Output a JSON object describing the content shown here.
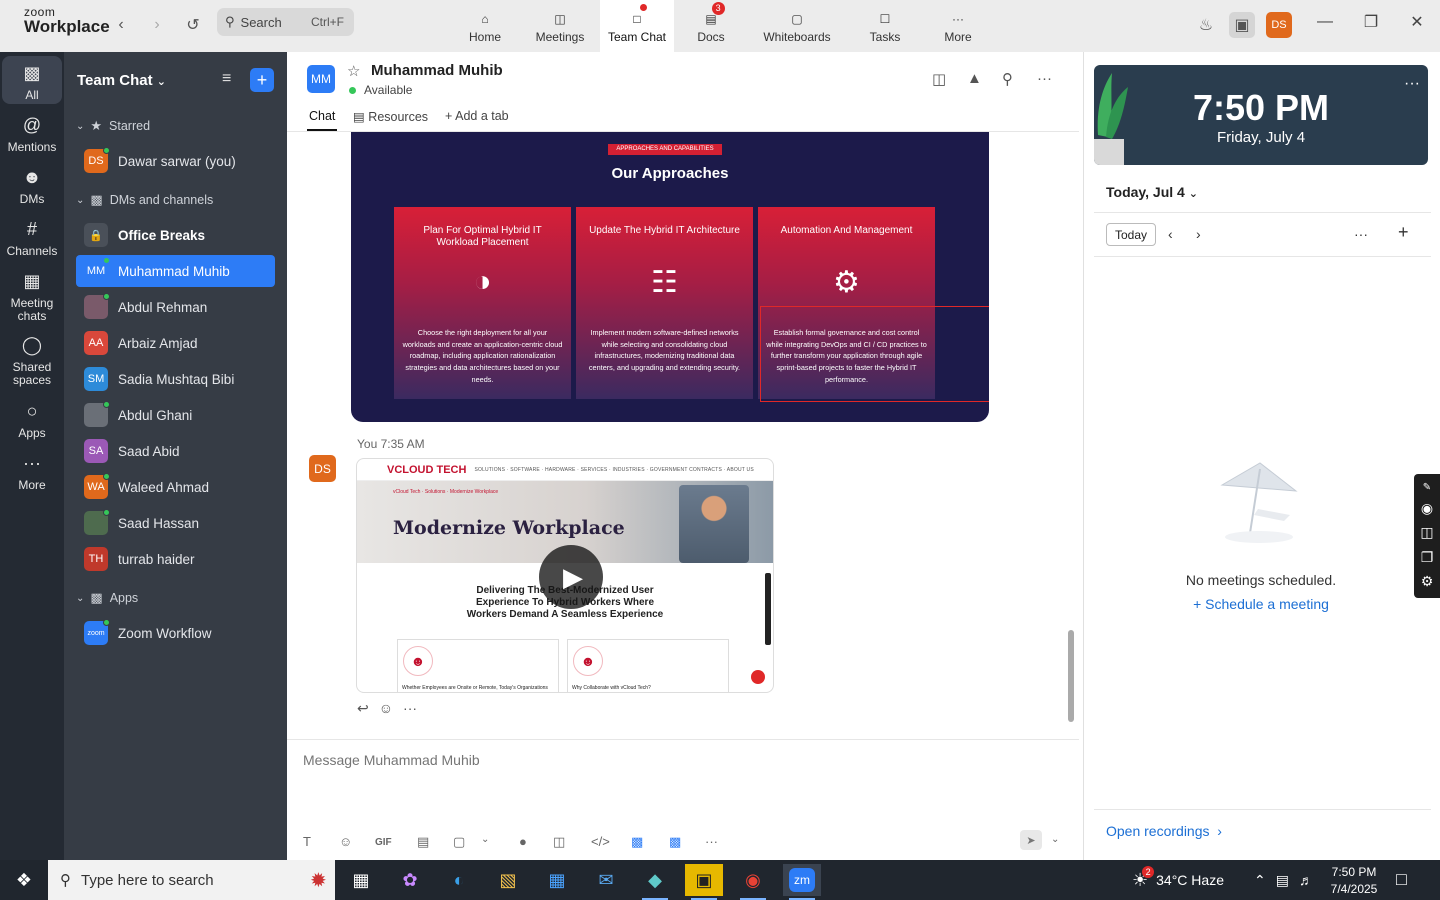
{
  "app": {
    "brand_top": "zoom",
    "brand_bottom": "Workplace"
  },
  "search": {
    "label": "Search",
    "shortcut": "Ctrl+F"
  },
  "nav": [
    {
      "label": "Home"
    },
    {
      "label": "Meetings"
    },
    {
      "label": "Team Chat"
    },
    {
      "label": "Docs",
      "badge": "3"
    },
    {
      "label": "Whiteboards"
    },
    {
      "label": "Tasks"
    },
    {
      "label": "More"
    }
  ],
  "user": {
    "initials": "DS"
  },
  "rail": [
    {
      "label": "All"
    },
    {
      "label": "Mentions"
    },
    {
      "label": "DMs"
    },
    {
      "label": "Channels"
    },
    {
      "label": "Meeting chats"
    },
    {
      "label": "Shared spaces"
    },
    {
      "label": "Apps"
    },
    {
      "label": "More"
    }
  ],
  "chatlist": {
    "title": "Team Chat",
    "sections": {
      "starred": "Starred",
      "dms": "DMs and channels",
      "apps": "Apps"
    },
    "starred": [
      {
        "initials": "DS",
        "name": "Dawar sarwar (you)",
        "color": "#e0691c"
      }
    ],
    "items": [
      {
        "initials": "",
        "name": "Office Breaks",
        "color": "#4a5059"
      },
      {
        "initials": "MM",
        "name": "Muhammad Muhib",
        "color": "#2d7cf6"
      },
      {
        "initials": "",
        "name": "Abdul Rehman",
        "color": "#7a5a6a"
      },
      {
        "initials": "AA",
        "name": "Arbaiz Amjad",
        "color": "#d9483b"
      },
      {
        "initials": "SM",
        "name": "Sadia Mushtaq Bibi",
        "color": "#2d8bd9"
      },
      {
        "initials": "",
        "name": "Abdul Ghani",
        "color": "#6a6f77"
      },
      {
        "initials": "SA",
        "name": "Saad Abid",
        "color": "#9b59b6"
      },
      {
        "initials": "WA",
        "name": "Waleed Ahmad",
        "color": "#e0691c"
      },
      {
        "initials": "",
        "name": "Saad Hassan",
        "color": "#4e6b4e"
      },
      {
        "initials": "TH",
        "name": "turrab haider",
        "color": "#c0392b"
      }
    ],
    "apps": [
      {
        "initials": "zoom",
        "name": "Zoom Workflow",
        "color": "#2d7cf6"
      }
    ]
  },
  "chat": {
    "contact_initials": "MM",
    "contact_name": "Muhammad Muhib",
    "status": "Available",
    "tabs": [
      "Chat",
      "Resources",
      "Add a tab"
    ],
    "slide": {
      "tag": "APPROACHES AND CAPABILITIES",
      "title": "Our Approaches",
      "cards": [
        {
          "title": "Plan For Optimal Hybrid IT Workload Placement",
          "desc": "Choose the right deployment for all your workloads and create an application-centric cloud roadmap, including application rationalization strategies and data architectures based on your needs."
        },
        {
          "title": "Update The Hybrid IT Architecture",
          "desc": "Implement modern software-defined networks while selecting and consolidating cloud infrastructures, modernizing traditional data centers, and upgrading and extending security."
        },
        {
          "title": "Automation And Management",
          "desc": "Establish formal governance and cost control while integrating DevOps and CI / CD practices to further transform your application through agile sprint-based projects to faster the Hybrid IT performance."
        }
      ]
    },
    "message_meta": "You 7:35 AM",
    "message_author_initials": "DS",
    "video": {
      "brand": "VCLOUD TECH",
      "nav_links": "SOLUTIONS · SOFTWARE · HARDWARE · SERVICES · INDUSTRIES · GOVERNMENT CONTRACTS · ABOUT US",
      "crumb": "vCloud Tech · Solutions · Modernize Workplace",
      "hero_title": "Modernize Workplace",
      "subtitle_line1": "Delivering The Best-Modernized User",
      "subtitle_line2": "Experience To Hybrid Workers Where",
      "subtitle_line3": "Workers Demand A Seamless Experience",
      "card1": "Whether Employees are Onsite or Remote, Today's Organizations",
      "card2": "Why Collaborate with vCloud Tech?"
    },
    "composer_placeholder": "Message Muhammad Muhib"
  },
  "calendar": {
    "time": "7:50 PM",
    "date": "Friday, July 4",
    "header_date": "Today, Jul 4",
    "today_label": "Today",
    "empty": "No meetings scheduled.",
    "schedule": "Schedule a meeting",
    "recordings": "Open recordings"
  },
  "taskbar": {
    "search_placeholder": "Type here to search",
    "weather_badge": "2",
    "weather": "34°C  Haze",
    "time": "7:50 PM",
    "date": "7/4/2025"
  }
}
